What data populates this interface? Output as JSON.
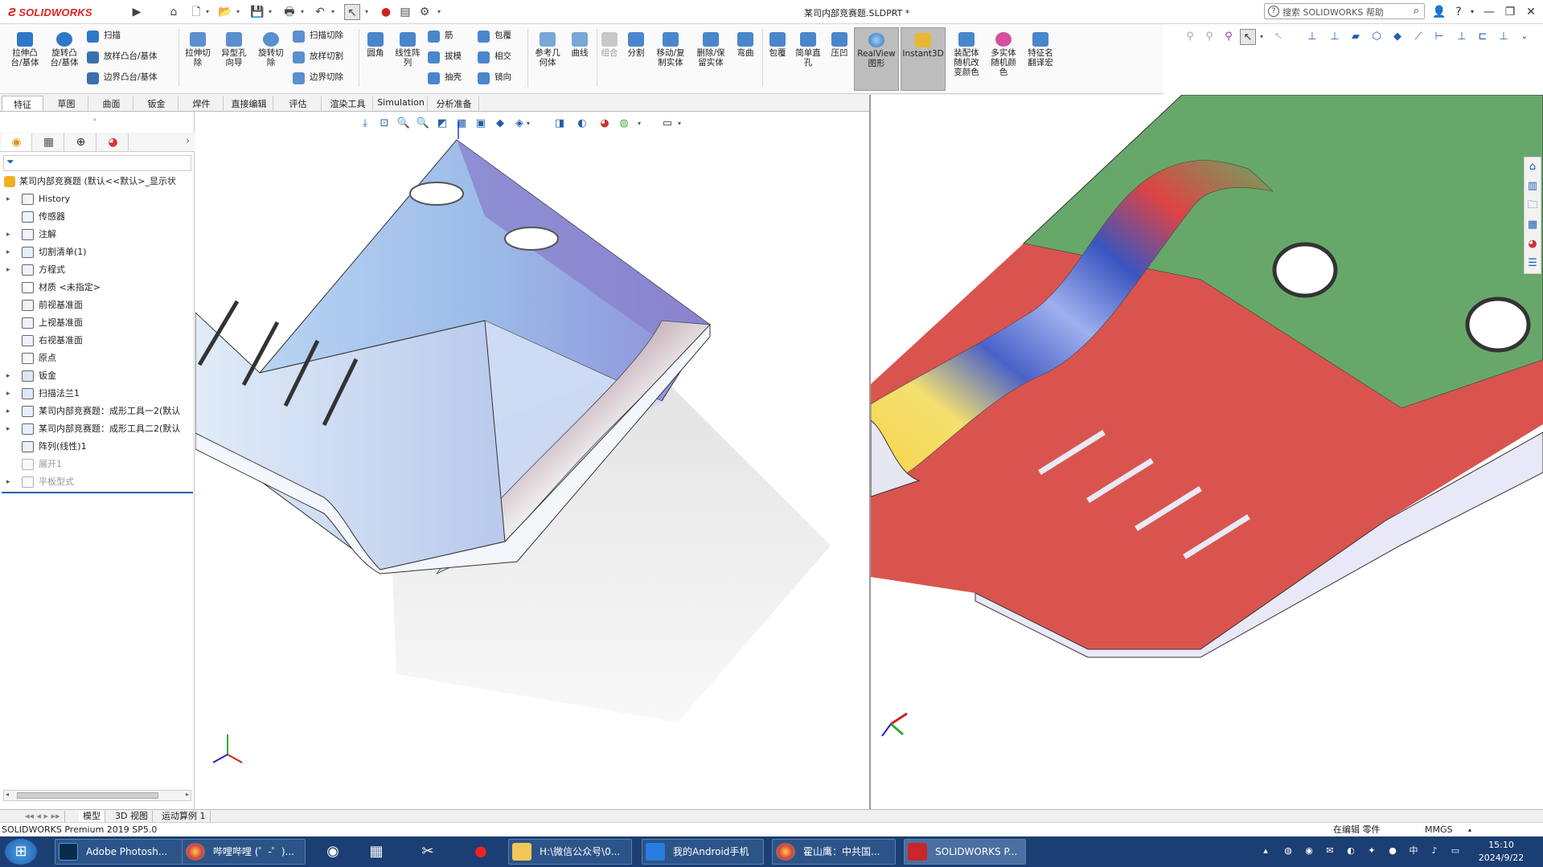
{
  "app": {
    "brand": "SOLIDWORKS",
    "window_title": "某司内部竞赛题.SLDPRT *",
    "help_search_placeholder": "搜索 SOLIDWORKS 帮助"
  },
  "ribbon": {
    "buttons": [
      {
        "label": "拉伸凸\n台/基体"
      },
      {
        "label": "旋转凸\n台/基体"
      },
      {
        "label": "扫描"
      },
      {
        "label": "放样凸台/基体"
      },
      {
        "label": "边界凸台/基体"
      },
      {
        "label": "拉伸切\n除"
      },
      {
        "label": "异型孔\n向导"
      },
      {
        "label": "旋转切\n除"
      },
      {
        "label": "扫描切除"
      },
      {
        "label": "放样切割"
      },
      {
        "label": "边界切除"
      },
      {
        "label": "圆角"
      },
      {
        "label": "线性阵\n列"
      },
      {
        "label": "筋"
      },
      {
        "label": "拔模"
      },
      {
        "label": "抽壳"
      },
      {
        "label": "包覆"
      },
      {
        "label": "相交"
      },
      {
        "label": "镜向"
      },
      {
        "label": "参考几\n何体"
      },
      {
        "label": "曲线"
      },
      {
        "label": "组合"
      },
      {
        "label": "分割"
      },
      {
        "label": "移动/复\n制实体"
      },
      {
        "label": "删除/保\n留实体"
      },
      {
        "label": "弯曲"
      },
      {
        "label": "包覆"
      },
      {
        "label": "简单直\n孔"
      },
      {
        "label": "压凹"
      },
      {
        "label": "RealView\n图形"
      },
      {
        "label": "Instant3D"
      },
      {
        "label": "装配体\n随机改\n变颜色"
      },
      {
        "label": "多实体\n随机颜\n色"
      },
      {
        "label": "特征名\n翻译宏"
      }
    ],
    "tabs": [
      "特征",
      "草图",
      "曲面",
      "钣金",
      "焊件",
      "直接编辑",
      "评估",
      "渲染工具",
      "Simulation",
      "分析准备"
    ]
  },
  "feature_tree": {
    "root": "某司内部竞赛题 (默认<<默认>_显示状",
    "items": [
      {
        "label": "History",
        "expandable": true
      },
      {
        "label": "传感器",
        "expandable": false
      },
      {
        "label": "注解",
        "expandable": true
      },
      {
        "label": "切割清单(1)",
        "expandable": true
      },
      {
        "label": "方程式",
        "expandable": true
      },
      {
        "label": "材质 <未指定>",
        "expandable": false
      },
      {
        "label": "前视基准面",
        "expandable": false
      },
      {
        "label": "上视基准面",
        "expandable": false
      },
      {
        "label": "右视基准面",
        "expandable": false
      },
      {
        "label": "原点",
        "expandable": false
      },
      {
        "label": "钣金",
        "expandable": true
      },
      {
        "label": "扫描法兰1",
        "expandable": true
      },
      {
        "label": "某司内部竞赛题：成形工具一2(默认",
        "expandable": true
      },
      {
        "label": "某司内部竞赛题：成形工具二2(默认",
        "expandable": true
      },
      {
        "label": "阵列(线性)1",
        "expandable": false
      },
      {
        "label": "展开1",
        "expandable": false,
        "dim": true
      },
      {
        "label": "平板型式",
        "expandable": true,
        "dim": true
      }
    ]
  },
  "bottom_tabs": [
    "模型",
    "3D 视图",
    "运动算例 1"
  ],
  "status": {
    "product": "SOLIDWORKS Premium 2019 SP5.0",
    "mode": "在编辑 零件",
    "units": "MMGS"
  },
  "taskbar": {
    "items": [
      {
        "label": "Adobe Photosh..."
      },
      {
        "label": "哔哩哔哩 (゜-゜)..."
      },
      {
        "label": "H:\\微信公众号\\0..."
      },
      {
        "label": "我的Android手机"
      },
      {
        "label": "霍山鹰：中共国..."
      },
      {
        "label": "SOLIDWORKS P..."
      }
    ],
    "time": "15:10",
    "date": "2024/9/22"
  }
}
